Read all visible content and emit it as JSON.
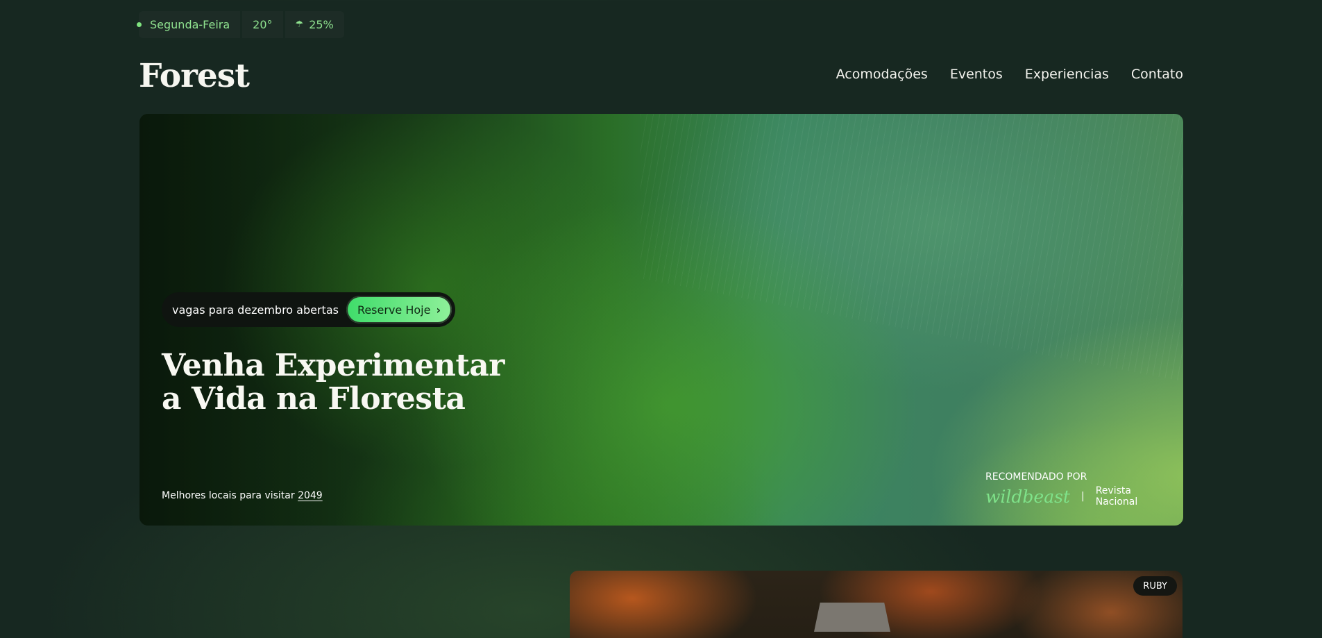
{
  "weather": {
    "day": "Segunda-Feira",
    "temperature": "20°",
    "rain_icon": "rain-cloud-icon",
    "rain_chance": "25%"
  },
  "header": {
    "logo": "Forest",
    "nav": [
      "Acomodações",
      "Eventos",
      "Experiencias",
      "Contato"
    ]
  },
  "hero": {
    "booking_text": "vagas para dezembro abertas",
    "booking_button": "Reserve Hoje",
    "headline_line1": "Venha Experimentar",
    "headline_line2": "a Vida na Floresta",
    "best_text": "Melhores locais para visitar ",
    "best_year": "2049",
    "recommended_label": "RECOMENDADO POR",
    "recommended_brand": "wildbeast",
    "recommended_separator": "|",
    "recommended_magazine": "Revista Nacional"
  },
  "card": {
    "badge": "RUBY"
  },
  "colors": {
    "background": "#172821",
    "accent": "#7fe38a",
    "button": "#3fdc6a"
  }
}
